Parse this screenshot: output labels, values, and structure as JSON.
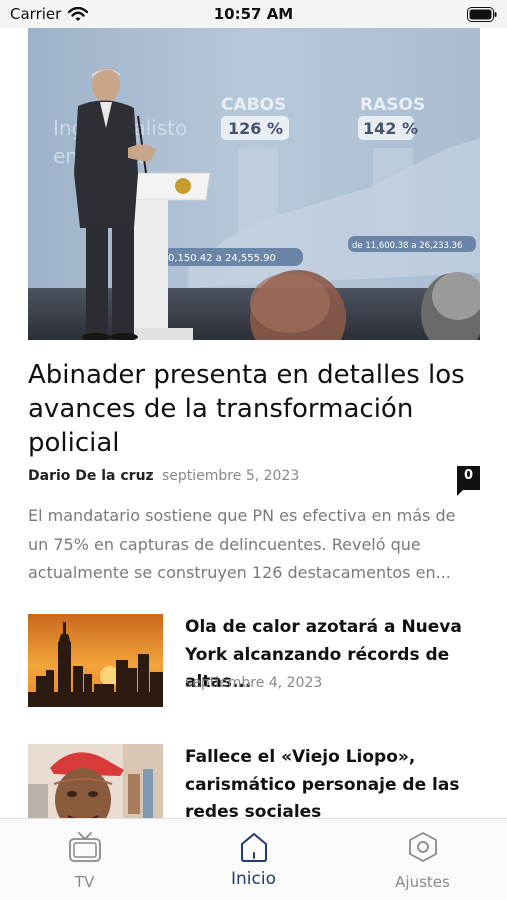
{
  "status_bar": {
    "carrier": "Carrier",
    "time": "10:57 AM"
  },
  "featured": {
    "title": "Abinader presenta en detalles los avances de la transformación policial",
    "author": "Dario De la cruz",
    "separator": "·",
    "date": "septiembre 5, 2023",
    "comment_count": "0",
    "excerpt": "El mandatario sostiene que PN es efectiva en más de un 75% en capturas de delincuentes. Reveló que actualmente se construyen 126 destacamentos en...",
    "image_text": {
      "left_faded": "Ingreso alisto",
      "left_faded_2": "en cursos",
      "col1_label": "CABOS",
      "col1_value": "126 %",
      "col2_label": "RASOS",
      "col2_value": "142 %",
      "range1": "0,150.42 a 24,555.90",
      "range2": "de 11,600.38 a 26,233.36"
    }
  },
  "articles": [
    {
      "title": "Ola de calor azotará a Nueva York alcanzando récords de altas...",
      "date": "septiembre 4, 2023"
    },
    {
      "title": "Fallece el «Viejo Liopo», carismático personaje de las redes sociales",
      "date": ""
    }
  ],
  "tab_bar": {
    "tabs": [
      {
        "label": "TV",
        "icon": "tv-icon",
        "active": false
      },
      {
        "label": "Inicio",
        "icon": "home-icon",
        "active": true
      },
      {
        "label": "Ajustes",
        "icon": "settings-icon",
        "active": false
      }
    ]
  },
  "colors": {
    "active_tab": "#243a72",
    "inactive_tab": "#8a8a8a",
    "excerpt_text": "#7a7a7a",
    "badge_bg": "#111111"
  }
}
